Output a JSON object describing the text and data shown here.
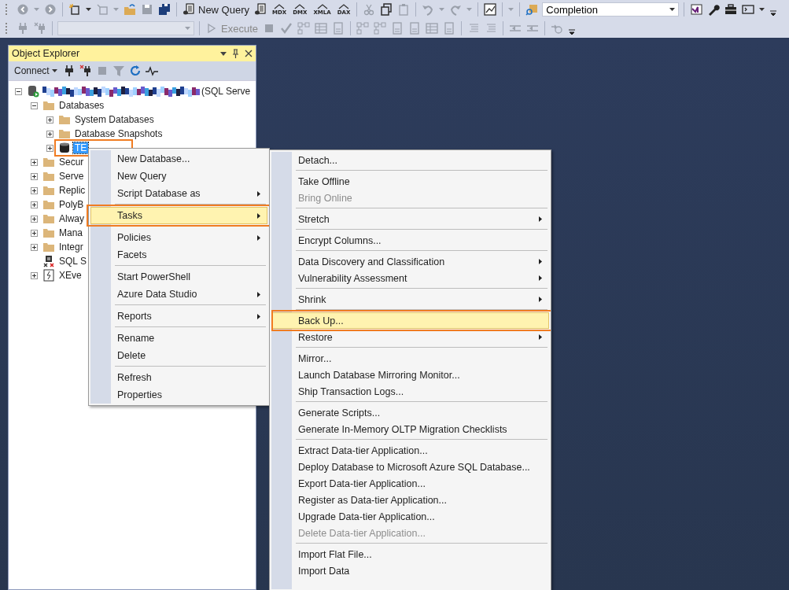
{
  "toolbar_1": {
    "new_query": "New Query",
    "query_types": [
      "MDX",
      "DMX",
      "XMLA",
      "DAX"
    ],
    "completion": "Completion"
  },
  "toolbar_2": {
    "execute": {
      "label": "Execute",
      "disabled": true
    }
  },
  "object_explorer": {
    "title": "Object Explorer",
    "connect": "Connect",
    "tree": [
      {
        "kind": "server",
        "label": "(SQL Serve",
        "expanded": true,
        "selected": false,
        "callout": false,
        "children": [
          {
            "kind": "folder",
            "label": "Databases",
            "expanded": true,
            "selected": false,
            "callout": false,
            "children": [
              {
                "kind": "folder",
                "label": "System Databases",
                "expanded": false,
                "selected": false,
                "callout": false
              },
              {
                "kind": "folder",
                "label": "Database Snapshots",
                "expanded": false,
                "selected": false,
                "callout": false
              },
              {
                "kind": "database",
                "label": "TE",
                "expanded": false,
                "selected": true,
                "callout": true
              }
            ]
          },
          {
            "kind": "folder",
            "label": "Secur",
            "expanded": false,
            "selected": false,
            "callout": false
          },
          {
            "kind": "folder",
            "label": "Serve",
            "expanded": false,
            "selected": false,
            "callout": false
          },
          {
            "kind": "folder",
            "label": "Replic",
            "expanded": false,
            "selected": false,
            "callout": false
          },
          {
            "kind": "folder",
            "label": "PolyB",
            "expanded": false,
            "selected": false,
            "callout": false
          },
          {
            "kind": "folder",
            "label": "Alway",
            "expanded": false,
            "selected": false,
            "callout": false
          },
          {
            "kind": "folder",
            "label": "Mana",
            "expanded": false,
            "selected": false,
            "callout": false
          },
          {
            "kind": "folder",
            "label": "Integr",
            "expanded": false,
            "selected": false,
            "callout": false
          },
          {
            "kind": "agent",
            "label": "SQL S",
            "selected": false,
            "callout": false
          },
          {
            "kind": "xevent",
            "label": "XEve",
            "expanded": false,
            "selected": false,
            "callout": false
          }
        ]
      }
    ]
  },
  "context_menu": [
    {
      "kind": "item",
      "label": "New Database...",
      "submenu": false,
      "selected": false,
      "disabled": false,
      "callout": false
    },
    {
      "kind": "item",
      "label": "New Query",
      "submenu": false,
      "selected": false,
      "disabled": false,
      "callout": false
    },
    {
      "kind": "item",
      "label": "Script Database as",
      "submenu": true,
      "selected": false,
      "disabled": false,
      "callout": false
    },
    {
      "kind": "sep"
    },
    {
      "kind": "item",
      "label": "Tasks",
      "submenu": true,
      "selected": true,
      "disabled": false,
      "callout": true
    },
    {
      "kind": "sep"
    },
    {
      "kind": "item",
      "label": "Policies",
      "submenu": true,
      "selected": false,
      "disabled": false,
      "callout": false
    },
    {
      "kind": "item",
      "label": "Facets",
      "submenu": false,
      "selected": false,
      "disabled": false,
      "callout": false
    },
    {
      "kind": "sep"
    },
    {
      "kind": "item",
      "label": "Start PowerShell",
      "submenu": false,
      "selected": false,
      "disabled": false,
      "callout": false
    },
    {
      "kind": "item",
      "label": "Azure Data Studio",
      "submenu": true,
      "selected": false,
      "disabled": false,
      "callout": false
    },
    {
      "kind": "sep"
    },
    {
      "kind": "item",
      "label": "Reports",
      "submenu": true,
      "selected": false,
      "disabled": false,
      "callout": false
    },
    {
      "kind": "sep"
    },
    {
      "kind": "item",
      "label": "Rename",
      "submenu": false,
      "selected": false,
      "disabled": false,
      "callout": false
    },
    {
      "kind": "item",
      "label": "Delete",
      "submenu": false,
      "selected": false,
      "disabled": false,
      "callout": false
    },
    {
      "kind": "sep"
    },
    {
      "kind": "item",
      "label": "Refresh",
      "submenu": false,
      "selected": false,
      "disabled": false,
      "callout": false
    },
    {
      "kind": "item",
      "label": "Properties",
      "submenu": false,
      "selected": false,
      "disabled": false,
      "callout": false
    }
  ],
  "tasks_menu": [
    {
      "kind": "item",
      "label": "Detach...",
      "submenu": false,
      "selected": false,
      "disabled": false,
      "callout": false
    },
    {
      "kind": "sep"
    },
    {
      "kind": "item",
      "label": "Take Offline",
      "submenu": false,
      "selected": false,
      "disabled": false,
      "callout": false
    },
    {
      "kind": "item",
      "label": "Bring Online",
      "submenu": false,
      "selected": false,
      "disabled": true,
      "callout": false
    },
    {
      "kind": "sep"
    },
    {
      "kind": "item",
      "label": "Stretch",
      "submenu": true,
      "selected": false,
      "disabled": false,
      "callout": false
    },
    {
      "kind": "sep"
    },
    {
      "kind": "item",
      "label": "Encrypt Columns...",
      "submenu": false,
      "selected": false,
      "disabled": false,
      "callout": false
    },
    {
      "kind": "sep"
    },
    {
      "kind": "item",
      "label": "Data Discovery and Classification",
      "submenu": true,
      "selected": false,
      "disabled": false,
      "callout": false
    },
    {
      "kind": "item",
      "label": "Vulnerability Assessment",
      "submenu": true,
      "selected": false,
      "disabled": false,
      "callout": false
    },
    {
      "kind": "sep"
    },
    {
      "kind": "item",
      "label": "Shrink",
      "submenu": true,
      "selected": false,
      "disabled": false,
      "callout": false
    },
    {
      "kind": "sep"
    },
    {
      "kind": "item",
      "label": "Back Up...",
      "submenu": false,
      "selected": true,
      "disabled": false,
      "callout": true
    },
    {
      "kind": "item",
      "label": "Restore",
      "submenu": true,
      "selected": false,
      "disabled": false,
      "callout": false
    },
    {
      "kind": "sep"
    },
    {
      "kind": "item",
      "label": "Mirror...",
      "submenu": false,
      "selected": false,
      "disabled": false,
      "callout": false
    },
    {
      "kind": "item",
      "label": "Launch Database Mirroring Monitor...",
      "submenu": false,
      "selected": false,
      "disabled": false,
      "callout": false
    },
    {
      "kind": "item",
      "label": "Ship Transaction Logs...",
      "submenu": false,
      "selected": false,
      "disabled": false,
      "callout": false
    },
    {
      "kind": "sep"
    },
    {
      "kind": "item",
      "label": "Generate Scripts...",
      "submenu": false,
      "selected": false,
      "disabled": false,
      "callout": false
    },
    {
      "kind": "item",
      "label": "Generate In-Memory OLTP Migration Checklists",
      "submenu": false,
      "selected": false,
      "disabled": false,
      "callout": false
    },
    {
      "kind": "sep"
    },
    {
      "kind": "item",
      "label": "Extract Data-tier Application...",
      "submenu": false,
      "selected": false,
      "disabled": false,
      "callout": false
    },
    {
      "kind": "item",
      "label": "Deploy Database to Microsoft Azure SQL Database...",
      "submenu": false,
      "selected": false,
      "disabled": false,
      "callout": false
    },
    {
      "kind": "item",
      "label": "Export Data-tier Application...",
      "submenu": false,
      "selected": false,
      "disabled": false,
      "callout": false
    },
    {
      "kind": "item",
      "label": "Register as Data-tier Application...",
      "submenu": false,
      "selected": false,
      "disabled": false,
      "callout": false
    },
    {
      "kind": "item",
      "label": "Upgrade Data-tier Application...",
      "submenu": false,
      "selected": false,
      "disabled": false,
      "callout": false
    },
    {
      "kind": "item",
      "label": "Delete Data-tier Application...",
      "submenu": false,
      "selected": false,
      "disabled": true,
      "callout": false
    },
    {
      "kind": "sep"
    },
    {
      "kind": "item",
      "label": "Import Flat File...",
      "submenu": false,
      "selected": false,
      "disabled": false,
      "callout": false
    },
    {
      "kind": "item",
      "label": "Import Data",
      "submenu": false,
      "selected": false,
      "disabled": false,
      "callout": false
    }
  ]
}
